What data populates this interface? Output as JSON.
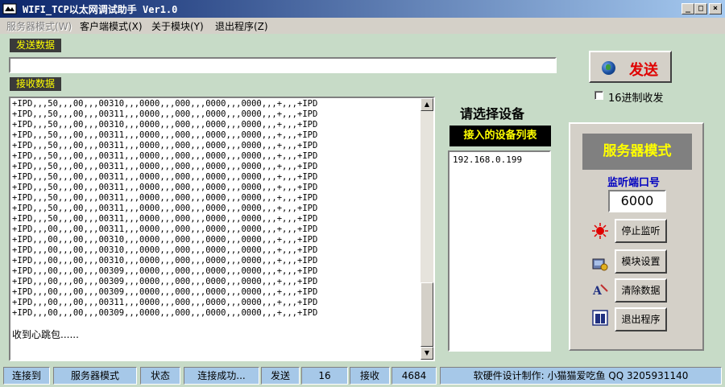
{
  "window": {
    "title": "WIFI_TCP以太网调试助手 Ver1.0",
    "min_glyph": "_",
    "max_glyph": "□",
    "close_glyph": "×"
  },
  "menu": {
    "items": [
      {
        "label": "服务器模式(W)"
      },
      {
        "label": "客户端模式(X)"
      },
      {
        "label": "关于模块(Y)"
      },
      {
        "label": "退出程序(Z)"
      }
    ]
  },
  "send_section": {
    "label": "发送数据",
    "input_value": ""
  },
  "recv_section": {
    "label": "接收数据",
    "lines": [
      "+IPD,,,50,,,00,,,00310,,,0000,,,000,,,0000,,,0000,,,+,,,+IPD",
      "+IPD,,,50,,,00,,,00311,,,0000,,,000,,,0000,,,0000,,,+,,,+IPD",
      "+IPD,,,50,,,00,,,00310,,,0000,,,000,,,0000,,,0000,,,+,,,+IPD",
      "+IPD,,,50,,,00,,,00311,,,0000,,,000,,,0000,,,0000,,,+,,,+IPD",
      "+IPD,,,50,,,00,,,00311,,,0000,,,000,,,0000,,,0000,,,+,,,+IPD",
      "+IPD,,,50,,,00,,,00311,,,0000,,,000,,,0000,,,0000,,,+,,,+IPD",
      "+IPD,,,50,,,00,,,00311,,,0000,,,000,,,0000,,,0000,,,+,,,+IPD",
      "+IPD,,,50,,,00,,,00311,,,0000,,,000,,,0000,,,0000,,,+,,,+IPD",
      "+IPD,,,50,,,00,,,00311,,,0000,,,000,,,0000,,,0000,,,+,,,+IPD",
      "+IPD,,,50,,,00,,,00311,,,0000,,,000,,,0000,,,0000,,,+,,,+IPD",
      "+IPD,,,50,,,00,,,00311,,,0000,,,000,,,0000,,,0000,,,+,,,+IPD",
      "+IPD,,,50,,,00,,,00311,,,0000,,,000,,,0000,,,0000,,,+,,,+IPD",
      "+IPD,,,00,,,00,,,00311,,,0000,,,000,,,0000,,,0000,,,+,,,+IPD",
      "+IPD,,,00,,,00,,,00310,,,0000,,,000,,,0000,,,0000,,,+,,,+IPD",
      "+IPD,,,00,,,00,,,00310,,,0000,,,000,,,0000,,,0000,,,+,,,+IPD",
      "+IPD,,,00,,,00,,,00310,,,0000,,,000,,,0000,,,0000,,,+,,,+IPD",
      "+IPD,,,00,,,00,,,00309,,,0000,,,000,,,0000,,,0000,,,+,,,+IPD",
      "+IPD,,,00,,,00,,,00309,,,0000,,,000,,,0000,,,0000,,,+,,,+IPD",
      "+IPD,,,00,,,00,,,00309,,,0000,,,000,,,0000,,,0000,,,+,,,+IPD",
      "+IPD,,,00,,,00,,,00311,,,0000,,,000,,,0000,,,0000,,,+,,,+IPD",
      "+IPD,,,00,,,00,,,00309,,,0000,,,000,,,0000,,,0000,,,+,,,+IPD"
    ],
    "heartbeat": "收到心跳包......"
  },
  "devices": {
    "prompt": "请选择设备",
    "list_title": "接入的设备列表",
    "items": [
      "192.168.0.199"
    ]
  },
  "send_button": {
    "label": "发送"
  },
  "hex_option": {
    "label": "16进制收发",
    "checked": false
  },
  "server_panel": {
    "mode_title": "服务器模式",
    "port_label": "监听端口号",
    "port_value": "6000",
    "buttons": {
      "stop": "停止监听",
      "settings": "模块设置",
      "clear": "清除数据",
      "exit": "退出程序"
    }
  },
  "statusbar": {
    "connect_label": "连接到",
    "mode": "服务器模式",
    "state_label": "状态",
    "state_value": "连接成功...",
    "send_label": "发送",
    "send_count": "16",
    "recv_label": "接收",
    "recv_count": "4684",
    "credits": "软硬件设计制作: 小猫猫爱吃鱼 QQ 3205931140"
  },
  "colors": {
    "background": "#c7dbc7",
    "title_start": "#0a246a",
    "title_end": "#a6caf0",
    "label_bg": "#3a3a3a",
    "label_text": "#ffff00",
    "send_text": "#e00000",
    "port_label": "#0000c0",
    "status_cell": "#a6c8e8"
  }
}
